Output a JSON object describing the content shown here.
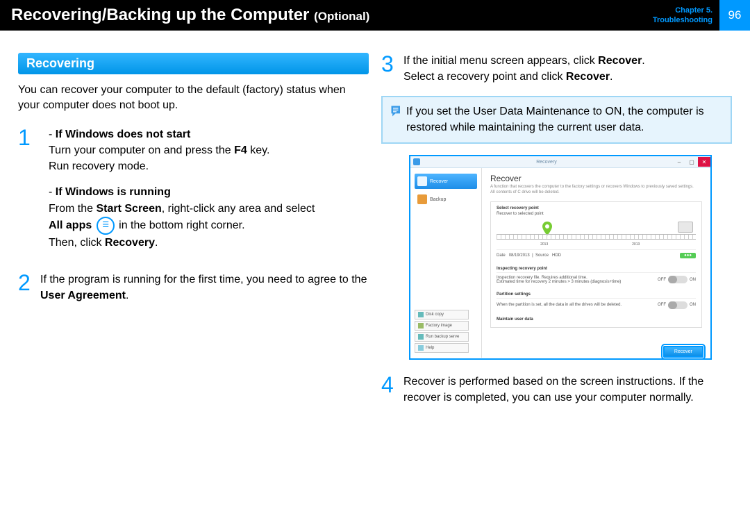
{
  "header": {
    "title_main": "Recovering/Backing up the Computer",
    "title_suffix": "(Optional)",
    "chapter_line1": "Chapter 5.",
    "chapter_line2": "Troubleshooting",
    "page_number": "96"
  },
  "left": {
    "section_title": "Recovering",
    "intro": "You can recover your computer to the default (factory) status when your computer does not boot up.",
    "step1_num": "1",
    "s1a_title": "If Windows does not start",
    "s1a_l1_pre": "Turn your computer on and press the ",
    "s1a_l1_key": "F4",
    "s1a_l1_post": " key.",
    "s1a_l2": "Run recovery mode.",
    "s1b_title": "If Windows is running",
    "s1b_l1_pre": "From the ",
    "s1b_l1_b": "Start Screen",
    "s1b_l1_post": ", right-click any area and select",
    "s1b_l2_b": "All apps",
    "s1b_l2_post": " in the bottom right corner.",
    "s1b_l3_pre": "Then, click ",
    "s1b_l3_b": "Recovery",
    "s1b_l3_post": ".",
    "step2_num": "2",
    "step2_pre": "If the program is running for the first time, you need to agree to the ",
    "step2_b": "User Agreement",
    "step2_post": "."
  },
  "right": {
    "step3_num": "3",
    "step3_l1_pre": "If the initial menu screen appears, click ",
    "step3_l1_b": "Recover",
    "step3_l1_post": ".",
    "step3_l2_pre": "Select a recovery point and click ",
    "step3_l2_b": "Recover",
    "step3_l2_post": ".",
    "note": "If you set the User Data Maintenance to ON, the computer is restored while maintaining the current user data.",
    "step4_num": "4",
    "step4": "Recover is performed based on the screen instructions. If the recover is completed, you can use your computer normally."
  },
  "screenshot": {
    "window_title": "Recovery",
    "side_recover": "Recover",
    "side_backup": "Backup",
    "bottom1": "Disk copy",
    "bottom2": "Factory image",
    "bottom3": "Run backup serve",
    "bottom4": "Help",
    "main_title": "Recover",
    "main_desc1": "A function that recovers the computer to the factory settings or recovers Windows to previously saved settings.",
    "main_desc2": "All contents of C drive will be deleted.",
    "panel_select": "Select recovery point",
    "panel_recover_to": "Recover to selected point",
    "t2013a": "2013",
    "t2013b": "2013",
    "date_lbl": "Date",
    "date_val": "08/19/2013",
    "source_lbl": "Source",
    "source_val": "HDD",
    "tag": "●●●",
    "sect_inspect": "Inspecting recovery point",
    "inspect_l1": "Inspection recovery file. Requires additional time.",
    "inspect_l2": "Estimated time for recovery 2 minutes > 3 minutes (diagnosis+time)",
    "off": "OFF",
    "on": "ON",
    "sect_partition": "Partition settings",
    "partition_l": "When the partition is set, all the data in all the drives will be deleted.",
    "sect_userdata": "Maintain user data",
    "btn": "Recover"
  }
}
